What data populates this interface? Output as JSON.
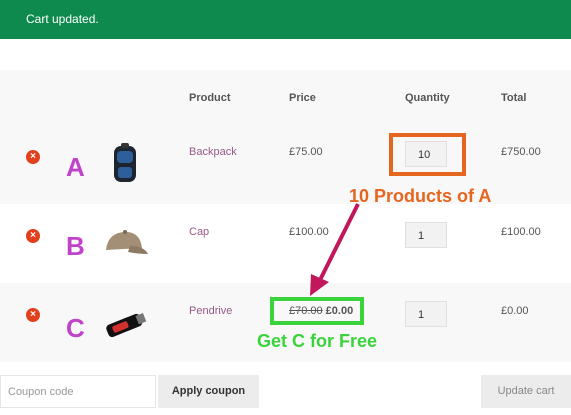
{
  "notice": {
    "message": "Cart updated."
  },
  "table": {
    "headers": {
      "product": "Product",
      "price": "Price",
      "quantity": "Quantity",
      "total": "Total"
    },
    "rows": [
      {
        "marker": "A",
        "name": "Backpack",
        "price": "£75.00",
        "quantity": "10",
        "total": "£750.00",
        "thumbnail": "backpack-image"
      },
      {
        "marker": "B",
        "name": "Cap",
        "price": "£100.00",
        "quantity": "1",
        "total": "£100.00",
        "thumbnail": "cap-image"
      },
      {
        "marker": "C",
        "name": "Pendrive",
        "price_old": "£70.00",
        "price_new": "£0.00",
        "quantity": "1",
        "total": "£0.00",
        "thumbnail": "pendrive-image"
      }
    ]
  },
  "annotations": {
    "quantity_note": "10 Products of A",
    "free_note": "Get C for Free",
    "orange": "#e4661f",
    "green": "#3bd33b",
    "arrow": "#c2185b"
  },
  "footer": {
    "coupon_placeholder": "Coupon code",
    "apply_label": "Apply coupon",
    "update_label": "Update cart"
  },
  "colors": {
    "notice_bg": "#0f8a4f",
    "product_link": "#96588a",
    "marker": "#c043c9",
    "remove": "#e2401c"
  }
}
